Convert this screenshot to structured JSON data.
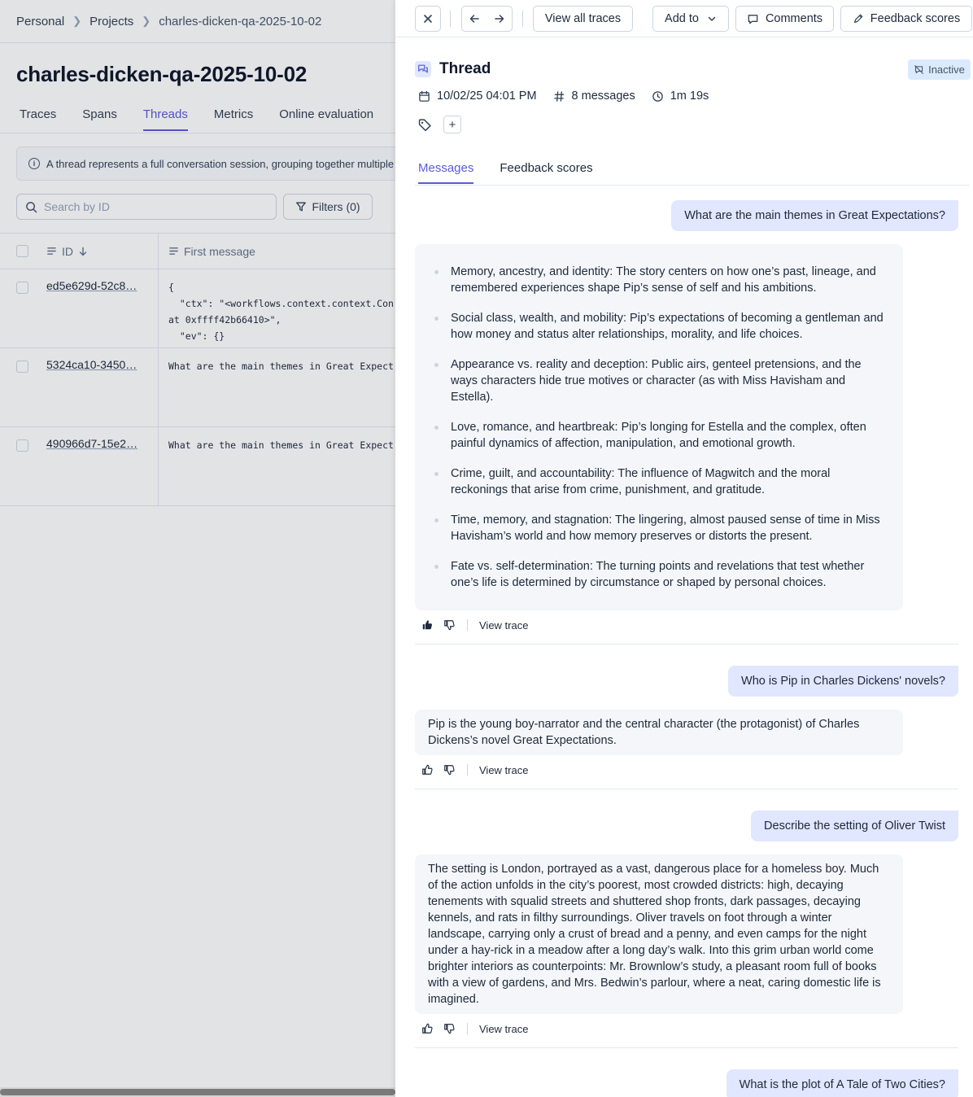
{
  "breadcrumb": [
    "Personal",
    "Projects",
    "charles-dicken-qa-2025-10-02"
  ],
  "project": {
    "title": "charles-dicken-qa-2025-10-02",
    "tabs": [
      "Traces",
      "Spans",
      "Threads",
      "Metrics",
      "Online evaluation"
    ],
    "active_tab": "Threads",
    "info_text": "A thread represents a full conversation session, grouping together multiple r",
    "search_placeholder": "Search by ID",
    "filters_label": "Filters (0)",
    "table": {
      "columns": [
        "ID",
        "First message"
      ],
      "rows": [
        {
          "id": "ed5e629d-52c8…",
          "first_message": "{\n  \"ctx\": \"<workflows.context.context.Con\nat 0xffff42b66410>\",\n  \"ev\": {}"
        },
        {
          "id": "5324ca10-3450…",
          "first_message": "What are the main themes in Great Expect"
        },
        {
          "id": "490966d7-15e2…",
          "first_message": "What are the main themes in Great Expect"
        }
      ]
    }
  },
  "panel": {
    "toolbar": {
      "view_all": "View all traces",
      "add_to": "Add to",
      "comments": "Comments",
      "feedback": "Feedback scores"
    },
    "title": "Thread",
    "status": "Inactive",
    "date": "10/02/25 04:01 PM",
    "messages_count": "8 messages",
    "duration": "1m 19s",
    "tabs": [
      "Messages",
      "Feedback scores"
    ],
    "active_tab": "Messages",
    "view_trace_label": "View trace",
    "conversation": [
      {
        "user": "What are the main themes in Great Expectations?",
        "assistant_list": [
          "Memory, ancestry, and identity: The story centers on how one’s past, lineage, and remembered experiences shape Pip’s sense of self and his ambitions.",
          "Social class, wealth, and mobility: Pip’s expectations of becoming a gentleman and how money and status alter relationships, morality, and life choices.",
          "Appearance vs. reality and deception: Public airs, genteel pretensions, and the ways characters hide true motives or character (as with Miss Havisham and Estella).",
          "Love, romance, and heartbreak: Pip’s longing for Estella and the complex, often painful dynamics of affection, manipulation, and emotional growth.",
          "Crime, guilt, and accountability: The influence of Magwitch and the moral reckonings that arise from crime, punishment, and gratitude.",
          "Time, memory, and stagnation: The lingering, almost paused sense of time in Miss Havisham’s world and how memory preserves or distorts the present.",
          "Fate vs. self-determination: The turning points and revelations that test whether one’s life is determined by circumstance or shaped by personal choices."
        ],
        "thumbs_up_active": true
      },
      {
        "user": "Who is Pip in Charles Dickens' novels?",
        "assistant": "Pip is the young boy-narrator and the central character (the protagonist) of Charles Dickens’s novel Great Expectations."
      },
      {
        "user": "Describe the setting of Oliver Twist",
        "assistant": "The setting is London, portrayed as a vast, dangerous place for a homeless boy. Much of the action unfolds in the city’s poorest, most crowded districts: high, decaying tenements with squalid streets and shuttered shop fronts, dark passages, decaying kennels, and rats in filthy surroundings. Oliver travels on foot through a winter landscape, carrying only a crust of bread and a penny, and even camps for the night under a hay-rick in a meadow after a long day’s walk. Into this grim urban world come brighter interiors as counterpoints: Mr. Brownlow’s study, a pleasant room full of books with a view of gardens, and Mrs. Bedwin’s parlour, where a neat, caring domestic life is imagined."
      },
      {
        "user": "What is the plot of A Tale of Two Cities?"
      }
    ]
  }
}
